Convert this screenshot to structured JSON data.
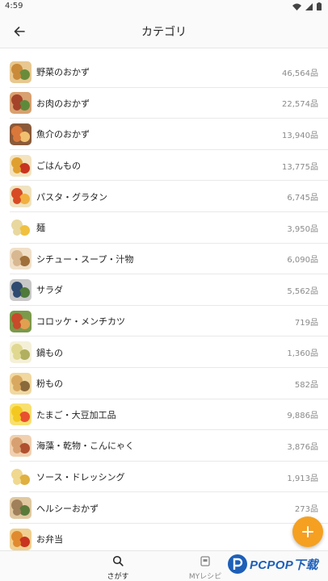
{
  "status_bar": {
    "time": "4:59"
  },
  "header": {
    "title": "カテゴリ",
    "back_icon": "arrow-left-icon"
  },
  "categories": [
    {
      "label": "野菜のおかず",
      "count": "46,564品",
      "colors": [
        "#c98a3a",
        "#6a8c3a",
        "#e8c890"
      ]
    },
    {
      "label": "お肉のおかず",
      "count": "22,574品",
      "colors": [
        "#a4432a",
        "#5d8a3a",
        "#d9a070"
      ]
    },
    {
      "label": "魚介のおかず",
      "count": "13,940品",
      "colors": [
        "#d9783a",
        "#f0c070",
        "#8a5a3a"
      ]
    },
    {
      "label": "ごはんもの",
      "count": "13,775品",
      "colors": [
        "#e0a030",
        "#c8341f",
        "#f3e3c0"
      ]
    },
    {
      "label": "パスタ・グラタン",
      "count": "6,745品",
      "colors": [
        "#d84a24",
        "#f0b040",
        "#efe3c0"
      ]
    },
    {
      "label": "麺",
      "count": "3,950品",
      "colors": [
        "#e8d8a0",
        "#f0c040",
        "#ffffff"
      ]
    },
    {
      "label": "シチュー・スープ・汁物",
      "count": "6,090品",
      "colors": [
        "#d8b890",
        "#a0703a",
        "#f0e0c8"
      ]
    },
    {
      "label": "サラダ",
      "count": "5,562品",
      "colors": [
        "#2e4a70",
        "#4f7a3a",
        "#c8c8c8"
      ]
    },
    {
      "label": "コロッケ・メンチカツ",
      "count": "719品",
      "colors": [
        "#c84a2a",
        "#e0a050",
        "#7a9a4a"
      ]
    },
    {
      "label": "鍋もの",
      "count": "1,360品",
      "colors": [
        "#e0d890",
        "#b0b060",
        "#f4f0d8"
      ]
    },
    {
      "label": "粉もの",
      "count": "582品",
      "colors": [
        "#d9a860",
        "#8a6a3a",
        "#f0d8a0"
      ]
    },
    {
      "label": "たまご・大豆加工品",
      "count": "9,886品",
      "colors": [
        "#f3c820",
        "#e85030",
        "#f8e070"
      ]
    },
    {
      "label": "海藻・乾物・こんにゃく",
      "count": "3,876品",
      "colors": [
        "#d8a070",
        "#b05030",
        "#f0d0b0"
      ]
    },
    {
      "label": "ソース・ドレッシング",
      "count": "1,913品",
      "colors": [
        "#f0d890",
        "#e0b040",
        "#ffffff"
      ]
    },
    {
      "label": "ヘルシーおかず",
      "count": "273品",
      "colors": [
        "#a0805a",
        "#5a7a3a",
        "#e0c8a0"
      ]
    },
    {
      "label": "お弁当",
      "count": "",
      "colors": [
        "#e08a30",
        "#c8341f",
        "#f0d090"
      ]
    }
  ],
  "fab": {
    "icon": "plus-icon",
    "color": "#f5a020"
  },
  "bottom_nav": {
    "search_label": "さがす",
    "search_icon": "search-icon",
    "myrecipe_label": "MYレシピ",
    "myrecipe_icon": "recipe-book-icon"
  },
  "watermark": {
    "text": "PCPOP下载"
  }
}
